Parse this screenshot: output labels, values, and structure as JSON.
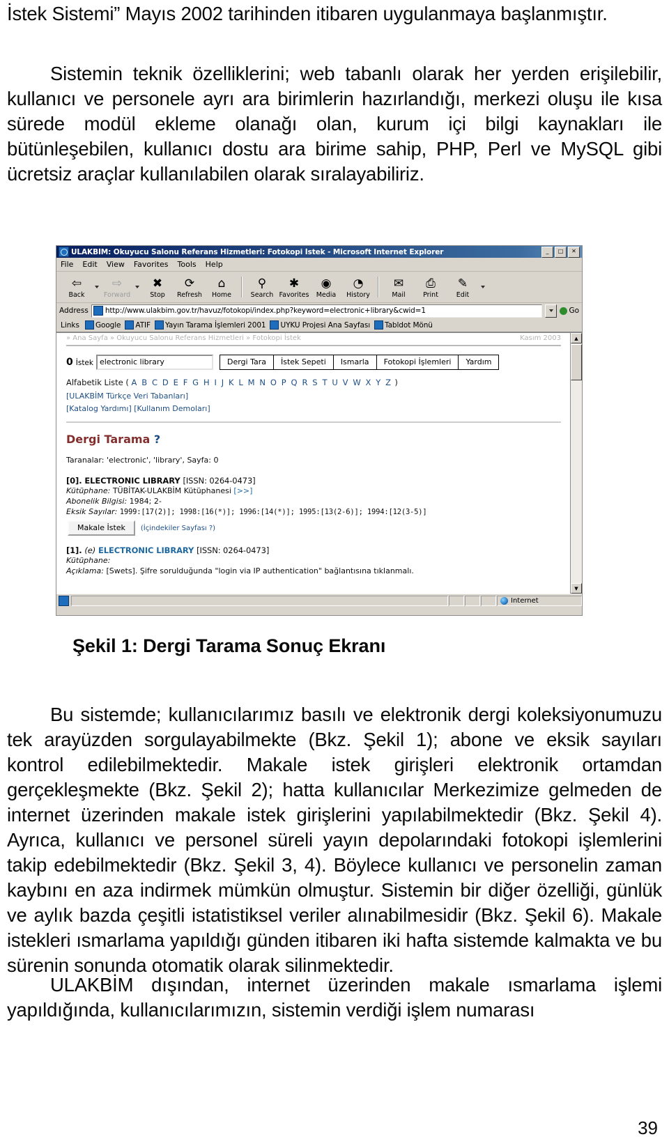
{
  "document": {
    "page_number": "39",
    "paragraphs": {
      "top": "İstek Sistemi” Mayıs 2002 tarihinden itibaren uygulanmaya başlanmıştır.",
      "technical": "Sistemin teknik özelliklerini; web tabanlı olarak her yerden erişilebilir, kullanıcı ve personele ayrı ara birimlerin hazırlandığı, merkezi oluşu ile kısa sürede modül ekleme olanağı olan, kurum içi bilgi kaynakları ile bütünleşebilen, kullanıcı dostu ara birime sahip, PHP, Perl ve MySQL gibi ücretsiz araçlar kullanılabilen olarak sıralayabiliriz.",
      "after_figure": "Bu sistemde; kullanıcılarımız basılı ve elektronik dergi koleksiyonumuzu tek arayüzden sorgulayabilmekte (Bkz. Şekil 1); abone ve eksik sayıları kontrol edilebilmektedir. Makale istek girişleri elektronik ortamdan gerçekleşmekte (Bkz. Şekil 2); hatta kullanıcılar Merkezimize gelmeden de internet üzerinden makale istek girişlerini yapılabilmektedir (Bkz. Şekil 4). Ayrıca, kullanıcı ve personel süreli yayın depolarındaki fotokopi işlemlerini takip edebilmektedir (Bkz. Şekil 3, 4). Böylece kullanıcı ve personelin zaman kaybını en aza indirmek mümkün olmuştur. Sistemin bir diğer özelliği, günlük ve aylık bazda çeşitli istatistiksel veriler alınabilmesidir (Bkz. Şekil 6). Makale istekleri ısmarlama yapıldığı günden itibaren iki hafta sistemde kalmakta ve bu sürenin sonunda otomatik olarak silinmektedir.",
      "last": "ULAKBİM dışından, internet üzerinden makale ısmarlama işlemi yapıldığında, kullanıcılarımızın, sistemin verdiği işlem numarası"
    },
    "figure_caption": "Şekil 1: Dergi Tarama Sonuç Ekranı"
  },
  "browser": {
    "title": "ULAKBİM: Okuyucu Salonu Referans Hizmetleri: Fotokopi İstek - Microsoft Internet Explorer",
    "window_buttons": [
      "_",
      "□",
      "✕"
    ],
    "menu": [
      "File",
      "Edit",
      "View",
      "Favorites",
      "Tools",
      "Help"
    ],
    "toolbar": [
      {
        "label": "Back",
        "icon": "back-arrow-icon",
        "glyph": "⇦",
        "dim": false,
        "dropdown": true
      },
      {
        "label": "Forward",
        "icon": "forward-arrow-icon",
        "glyph": "⇨",
        "dim": true,
        "dropdown": true
      },
      {
        "label": "Stop",
        "icon": "stop-icon",
        "glyph": "✖",
        "dim": false,
        "dropdown": false
      },
      {
        "label": "Refresh",
        "icon": "refresh-icon",
        "glyph": "⟳",
        "dim": false,
        "dropdown": false
      },
      {
        "label": "Home",
        "icon": "home-icon",
        "glyph": "⌂",
        "dim": false,
        "dropdown": false
      },
      {
        "label": "Search",
        "icon": "search-icon",
        "glyph": "🔍",
        "dim": false,
        "dropdown": false
      },
      {
        "label": "Favorites",
        "icon": "favorites-star-icon",
        "glyph": "✱",
        "dim": false,
        "dropdown": false
      },
      {
        "label": "Media",
        "icon": "media-icon",
        "glyph": "◉",
        "dim": false,
        "dropdown": false
      },
      {
        "label": "History",
        "icon": "history-icon",
        "glyph": "◔",
        "dim": false,
        "dropdown": false
      },
      {
        "label": "Mail",
        "icon": "mail-icon",
        "glyph": "✉",
        "dim": false,
        "dropdown": true
      },
      {
        "label": "Print",
        "icon": "printer-icon",
        "glyph": "⎙",
        "dim": false,
        "dropdown": false
      },
      {
        "label": "Edit",
        "icon": "edit-icon",
        "glyph": "✎",
        "dim": false,
        "dropdown": true
      }
    ],
    "address": {
      "label": "Address",
      "url": "http://www.ulakbim.gov.tr/havuz/fotokopi/index.php?keyword=electronic+library&cwid=1",
      "go_label": "Go"
    },
    "links": {
      "label": "Links",
      "items": [
        "Google",
        "ATIF",
        "Yayın Tarama İşlemleri 2001",
        "UYKU Projesi Ana Sayfası",
        "Tabldot Mönü"
      ]
    },
    "statusbar": {
      "zone": "Internet"
    }
  },
  "page_content": {
    "breadcrumb": "» Ana Sayfa » Okuyucu Salonu Referans Hizmetleri » Fotokopi İstek",
    "date": "Kasım 2003",
    "nav": {
      "count": "0",
      "count_label": "İstek",
      "search_value": "electronic library",
      "search_placeholder": "",
      "buttons": [
        "Dergi Tara",
        "İstek Sepeti",
        "Ismarla",
        "Fotokopi İşlemleri",
        "Yardım"
      ]
    },
    "alphabetic": {
      "label": "Alfabetik Liste (",
      "letters": "A B C D E F G H I J K L M N O P Q R S T U V W X Y Z",
      "close": ")"
    },
    "sublinks": [
      "[ULAKBİM Türkçe Veri Tabanları]",
      "[Katalog Yardımı]  [Kullanım Demoları]"
    ],
    "section_title": "Dergi Tarama",
    "section_title_help": "?",
    "scanned_line": "Taranalar: 'electronic', 'library', Sayfa: 0",
    "records": [
      {
        "index": "[0].",
        "etag": "",
        "title": "ELECTRONIC LIBRARY",
        "issn": "[ISSN: 0264-0473]",
        "library_label": "Kütüphane:",
        "library_value": "TÜBİTAK-ULAKBİM Kütüphanesi",
        "library_link": "[>>]",
        "subscription_label": "Abonelik Bilgisi:",
        "subscription_value": "1984; 2-",
        "missing_label": "Eksik Sayılar:",
        "missing_value": "1999:[17(2)]; 1998:[16(*)]; 1996:[14(*)]; 1995:[13(2-6)]; 1994:[12(3-5)]",
        "request_button": "Makale İstek",
        "request_note": "(İçindekiler Sayfası ?)",
        "description_label": "",
        "description_value": ""
      },
      {
        "index": "[1].",
        "etag": "(e)",
        "title": "ELECTRONIC LIBRARY",
        "issn": "[ISSN: 0264-0473]",
        "library_label": "Kütüphane:",
        "library_value": "",
        "library_link": "",
        "subscription_label": "",
        "subscription_value": "",
        "missing_label": "",
        "missing_value": "",
        "request_button": "",
        "request_note": "",
        "description_label": "Açıklama:",
        "description_value": "[Swets]. Şifre sorulduğunda \"login via IP authentication\" bağlantısına tıklanmalı."
      }
    ]
  },
  "colors": {
    "titlebar": "#0a246a",
    "chrome": "#d4d0c8",
    "link": "#1b4f8a",
    "heading": "#8c2f2f"
  }
}
